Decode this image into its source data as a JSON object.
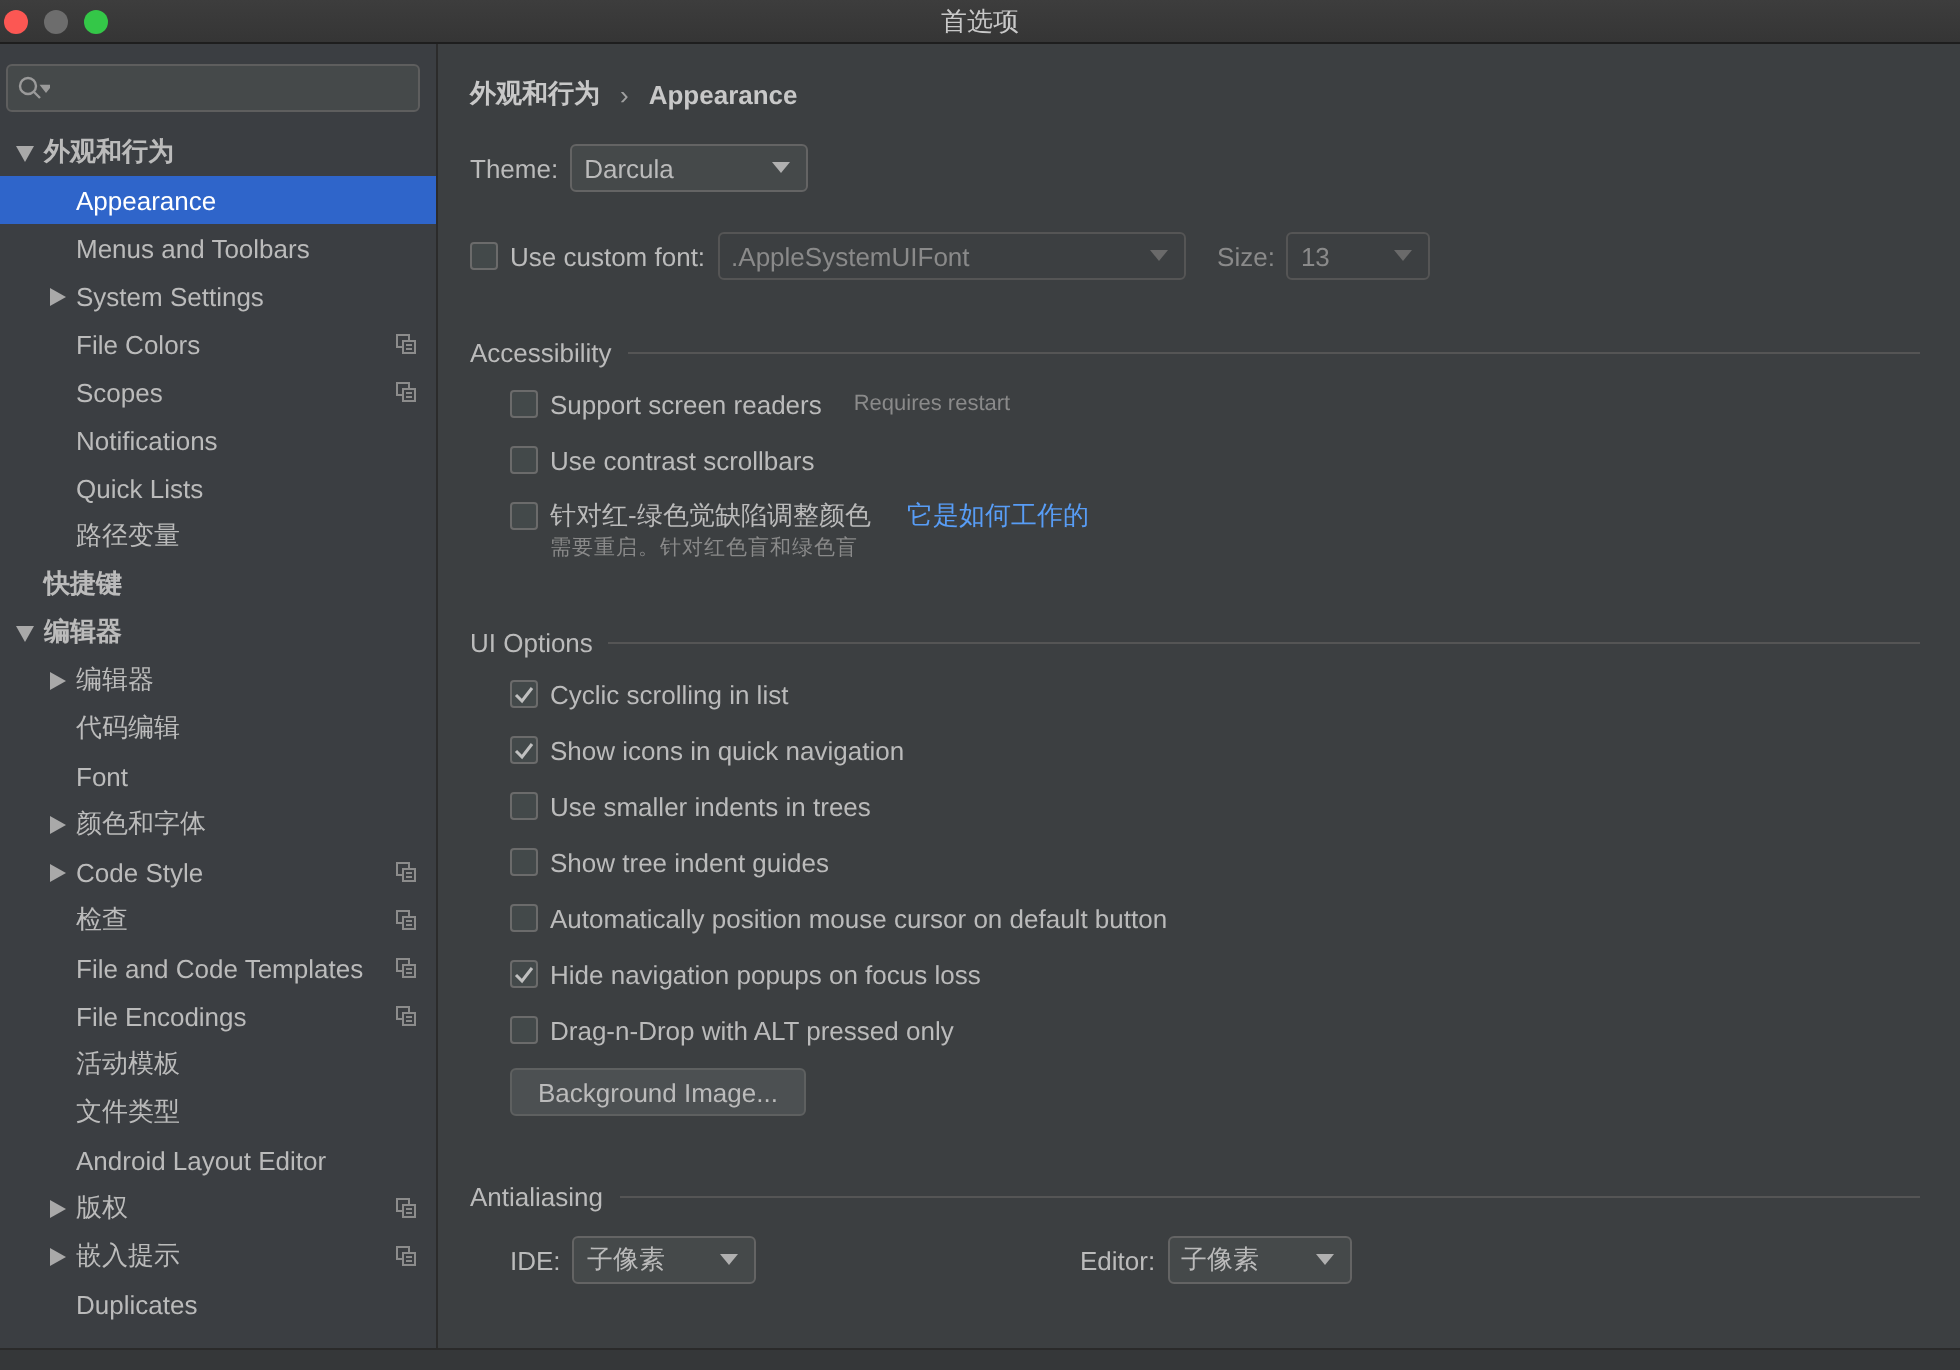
{
  "window": {
    "title": "首选项"
  },
  "sidebar": {
    "items": [
      {
        "label": "外观和行为",
        "selected": false,
        "expanded": true,
        "children": [
          {
            "label": "Appearance",
            "selected": true,
            "project": false
          },
          {
            "label": "Menus and Toolbars",
            "selected": false,
            "project": false
          },
          {
            "label": "System Settings",
            "selected": false,
            "expanded": false,
            "project": false
          },
          {
            "label": "File Colors",
            "selected": false,
            "project": true
          },
          {
            "label": "Scopes",
            "selected": false,
            "project": true
          },
          {
            "label": "Notifications",
            "selected": false,
            "project": false
          },
          {
            "label": "Quick Lists",
            "selected": false,
            "project": false
          },
          {
            "label": "路径变量",
            "selected": false,
            "project": false
          }
        ]
      },
      {
        "label": "快捷键",
        "selected": false
      },
      {
        "label": "编辑器",
        "selected": false,
        "expanded": true,
        "children": [
          {
            "label": "编辑器",
            "selected": false,
            "expanded": false,
            "project": false
          },
          {
            "label": "代码编辑",
            "selected": false,
            "project": false
          },
          {
            "label": "Font",
            "selected": false,
            "project": false
          },
          {
            "label": "颜色和字体",
            "selected": false,
            "expanded": false,
            "project": false
          },
          {
            "label": "Code Style",
            "selected": false,
            "expanded": false,
            "project": true
          },
          {
            "label": "检查",
            "selected": false,
            "project": true
          },
          {
            "label": "File and Code Templates",
            "selected": false,
            "project": true
          },
          {
            "label": "File Encodings",
            "selected": false,
            "project": true
          },
          {
            "label": "活动模板",
            "selected": false,
            "project": false
          },
          {
            "label": "文件类型",
            "selected": false,
            "project": false
          },
          {
            "label": "Android Layout Editor",
            "selected": false,
            "project": false
          },
          {
            "label": "版权",
            "selected": false,
            "expanded": false,
            "project": true
          },
          {
            "label": "嵌入提示",
            "selected": false,
            "expanded": false,
            "project": true
          },
          {
            "label": "Duplicates",
            "selected": false,
            "project": false
          }
        ]
      }
    ]
  },
  "breadcrumb": {
    "parent": "外观和行为",
    "separator": "›",
    "current": "Appearance"
  },
  "theme": {
    "label": "Theme:",
    "value": "Darcula"
  },
  "custom_font": {
    "label": "Use custom font:",
    "checked": false,
    "value": ".AppleSystemUIFont",
    "size_label": "Size:",
    "size": "13",
    "disabled": true
  },
  "sections": [
    {
      "title": "Accessibility",
      "kind": "checks",
      "options": [
        {
          "label": "Support screen readers",
          "checked": false,
          "note": "Requires restart"
        },
        {
          "label": "Use contrast scrollbars",
          "checked": false
        },
        {
          "label": "针对红-绿色觉缺陷调整颜色",
          "checked": false,
          "link": "它是如何工作的",
          "hint": "需要重启。针对红色盲和绿色盲"
        }
      ]
    },
    {
      "title": "UI Options",
      "kind": "checks",
      "options": [
        {
          "label": "Cyclic scrolling in list",
          "checked": true
        },
        {
          "label": "Show icons in quick navigation",
          "checked": true
        },
        {
          "label": "Use smaller indents in trees",
          "checked": false
        },
        {
          "label": "Show tree indent guides",
          "checked": false
        },
        {
          "label": "Automatically position mouse cursor on default button",
          "checked": false
        },
        {
          "label": "Hide navigation popups on focus loss",
          "checked": true
        },
        {
          "label": "Drag-n-Drop with ALT pressed only",
          "checked": false
        }
      ],
      "button": "Background Image..."
    },
    {
      "title": "Antialiasing",
      "kind": "selects",
      "selects": [
        {
          "label": "IDE:",
          "value": "子像素"
        },
        {
          "label": "Editor:",
          "value": "子像素"
        }
      ]
    }
  ]
}
